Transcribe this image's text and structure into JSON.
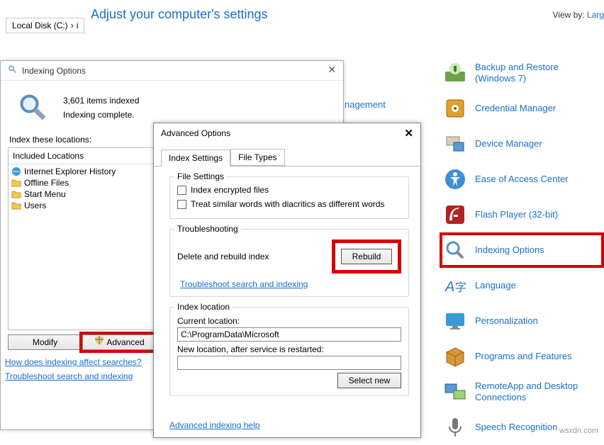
{
  "breadcrumb": {
    "part1": "Local Disk (C:)",
    "arrow": "›",
    "part2": "i"
  },
  "cp": {
    "title": "Adjust your computer's settings",
    "viewby_label": "View by:",
    "viewby_value": "Larg",
    "items": [
      {
        "label": "Backup and Restore (Windows 7)"
      },
      {
        "label": "Credential Manager"
      },
      {
        "label": "Device Manager"
      },
      {
        "label": "Ease of Access Center"
      },
      {
        "label": "Flash Player (32-bit)"
      },
      {
        "label": "Indexing Options"
      },
      {
        "label": "Language"
      },
      {
        "label": "Personalization"
      },
      {
        "label": "Programs and Features"
      },
      {
        "label": "RemoteApp and Desktop Connections"
      },
      {
        "label": "Speech Recognition"
      }
    ],
    "fragment": "nagement"
  },
  "idx": {
    "title": "Indexing Options",
    "count_line": "3,601 items indexed",
    "status_line": "Indexing complete.",
    "locations_label": "Index these locations:",
    "column_header": "Included Locations",
    "locations": [
      "Internet Explorer History",
      "Offline Files",
      "Start Menu",
      "Users"
    ],
    "modify_btn": "Modify",
    "advanced_btn": "Advanced",
    "link1": "How does indexing affect searches?",
    "link2": "Troubleshoot search and indexing"
  },
  "adv": {
    "title": "Advanced Options",
    "tab1": "Index Settings",
    "tab2": "File Types",
    "group_file": "File Settings",
    "chk_encrypted": "Index encrypted files",
    "chk_diacritics": "Treat similar words with diacritics as different words",
    "group_trouble": "Troubleshooting",
    "delete_rebuild": "Delete and rebuild index",
    "rebuild_btn": "Rebuild",
    "trouble_link": "Troubleshoot search and indexing",
    "group_loc": "Index location",
    "current_loc_label": "Current location:",
    "current_loc_value": "C:\\ProgramData\\Microsoft",
    "new_loc_label": "New location, after service is restarted:",
    "new_loc_value": "",
    "select_new_btn": "Select new",
    "footer_link": "Advanced indexing help"
  },
  "watermark": "wsxdn.com"
}
